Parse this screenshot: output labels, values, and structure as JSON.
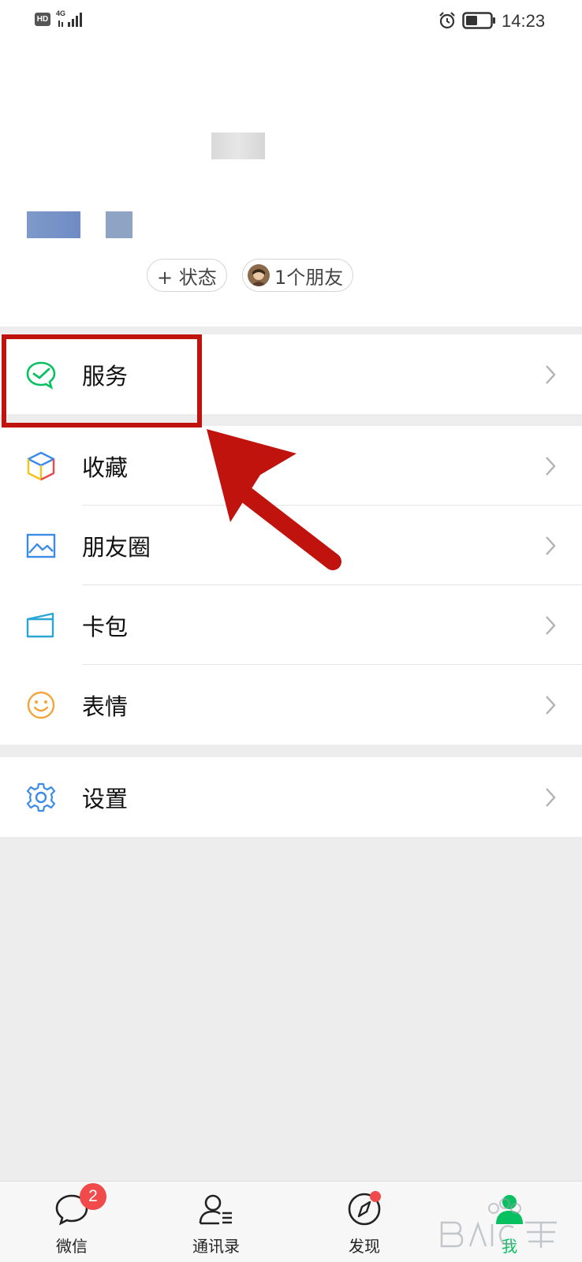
{
  "status_bar": {
    "network": "4G",
    "time": "14:23"
  },
  "profile": {
    "chips": [
      {
        "label": "+ 状态"
      },
      {
        "label": "1个朋友"
      }
    ]
  },
  "menu": {
    "services": {
      "label": "服务"
    },
    "favorites": {
      "label": "收藏"
    },
    "moments": {
      "label": "朋友圈"
    },
    "cards": {
      "label": "卡包"
    },
    "stickers": {
      "label": "表情"
    },
    "settings": {
      "label": "设置"
    }
  },
  "tabs": [
    {
      "label": "微信",
      "badge": "2",
      "icon": "chat-icon"
    },
    {
      "label": "通讯录",
      "icon": "contacts-icon"
    },
    {
      "label": "发现",
      "icon": "compass-icon"
    },
    {
      "label": "我",
      "icon": "me-icon"
    }
  ],
  "colors": {
    "accent": "#07c160",
    "badge": "#f04a4a",
    "highlight": "#c0130e"
  }
}
